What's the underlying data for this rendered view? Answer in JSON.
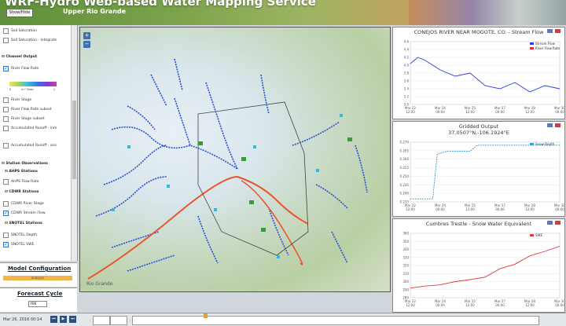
{
  "header": {
    "title": "WRF-Hydro Web-based Water Mapping Service",
    "button_label": "Show/Hide",
    "region": "Upper Rio Grande"
  },
  "sidebar": {
    "items": [
      {
        "label": "Soil Saturation",
        "checked": false
      },
      {
        "label": "Soil Saturation - Integrate",
        "checked": false
      },
      {
        "section": "Channel Output"
      },
      {
        "label": "River Flow Rate",
        "checked": true
      },
      {
        "label": "River Stage",
        "checked": false
      },
      {
        "label": "River Flow Rate subset",
        "checked": false
      },
      {
        "label": "River Stage subset",
        "checked": false
      },
      {
        "label": "Accumulated Runoff - inm",
        "checked": false
      },
      {
        "label": "Accumulated Runoff - sea",
        "checked": false
      },
      {
        "section": "Station Observations"
      },
      {
        "section": "AHPS Stations"
      },
      {
        "label": "AHPS Flow Rate",
        "checked": false
      },
      {
        "section": "CDWR Stations"
      },
      {
        "label": "CDWR River Stage",
        "checked": false
      },
      {
        "label": "CDWR Stream Flow",
        "checked": true
      },
      {
        "section": "SNOTEL Stations"
      },
      {
        "label": "SNOTEL Depth",
        "checked": false
      },
      {
        "label": "SNOTEL SWE",
        "checked": true
      }
    ],
    "legend_low": "0",
    "legend_mid": "m^3/sec",
    "legend_high": "1"
  },
  "model_config": {
    "heading": "Model Configuration",
    "value": "analysis"
  },
  "forecast": {
    "heading": "Forecast Cycle",
    "value": "f06"
  },
  "map": {
    "attribution": "Rio Grande"
  },
  "charts": [
    {
      "title": "CONEJOS RIVER NEAR MOGOTE, CO. - Stream Flow",
      "legend": [
        "Stream Flow",
        "River Flow Rate"
      ],
      "yticks": [
        "4.6",
        "4.4",
        "4.2",
        "4.0",
        "3.8",
        "3.6",
        "3.4",
        "3.2",
        "3.0"
      ],
      "xticks": [
        "Mar 22\n12:00",
        "Mar 24\n00:00",
        "Mar 25\n12:00",
        "Mar 27\n00:00",
        "Mar 28\n12:00",
        "Mar 30\n00:00"
      ]
    },
    {
      "title": "Gridded Output",
      "subtitle": "37.0507°N,-106.1924°E",
      "legend": [
        "Snow Depth"
      ],
      "yticks": [
        "0.270",
        "0.265",
        "0.260",
        "0.255",
        "0.250",
        "0.245",
        "0.240",
        "0.235"
      ],
      "xticks": [
        "Mar 22\n12:00",
        "Mar 24\n00:00",
        "Mar 25\n12:00",
        "Mar 27\n00:00",
        "Mar 28\n12:00",
        "Mar 30\n00:00"
      ]
    },
    {
      "title": "Cumbres Trestle - Snow Water Equivalent",
      "legend": [
        "SWE"
      ],
      "yticks": [
        "360",
        "350",
        "340",
        "330",
        "320",
        "310",
        "300",
        "290",
        "280"
      ],
      "xticks": [
        "Mar 22\n12:00",
        "Mar 24\n00:00",
        "Mar 25\n12:00",
        "Mar 27\n00:00",
        "Mar 28\n12:00",
        "Mar 30\n00:00"
      ]
    }
  ],
  "timeline": {
    "date": "Mar 26, 2016 00:14"
  }
}
